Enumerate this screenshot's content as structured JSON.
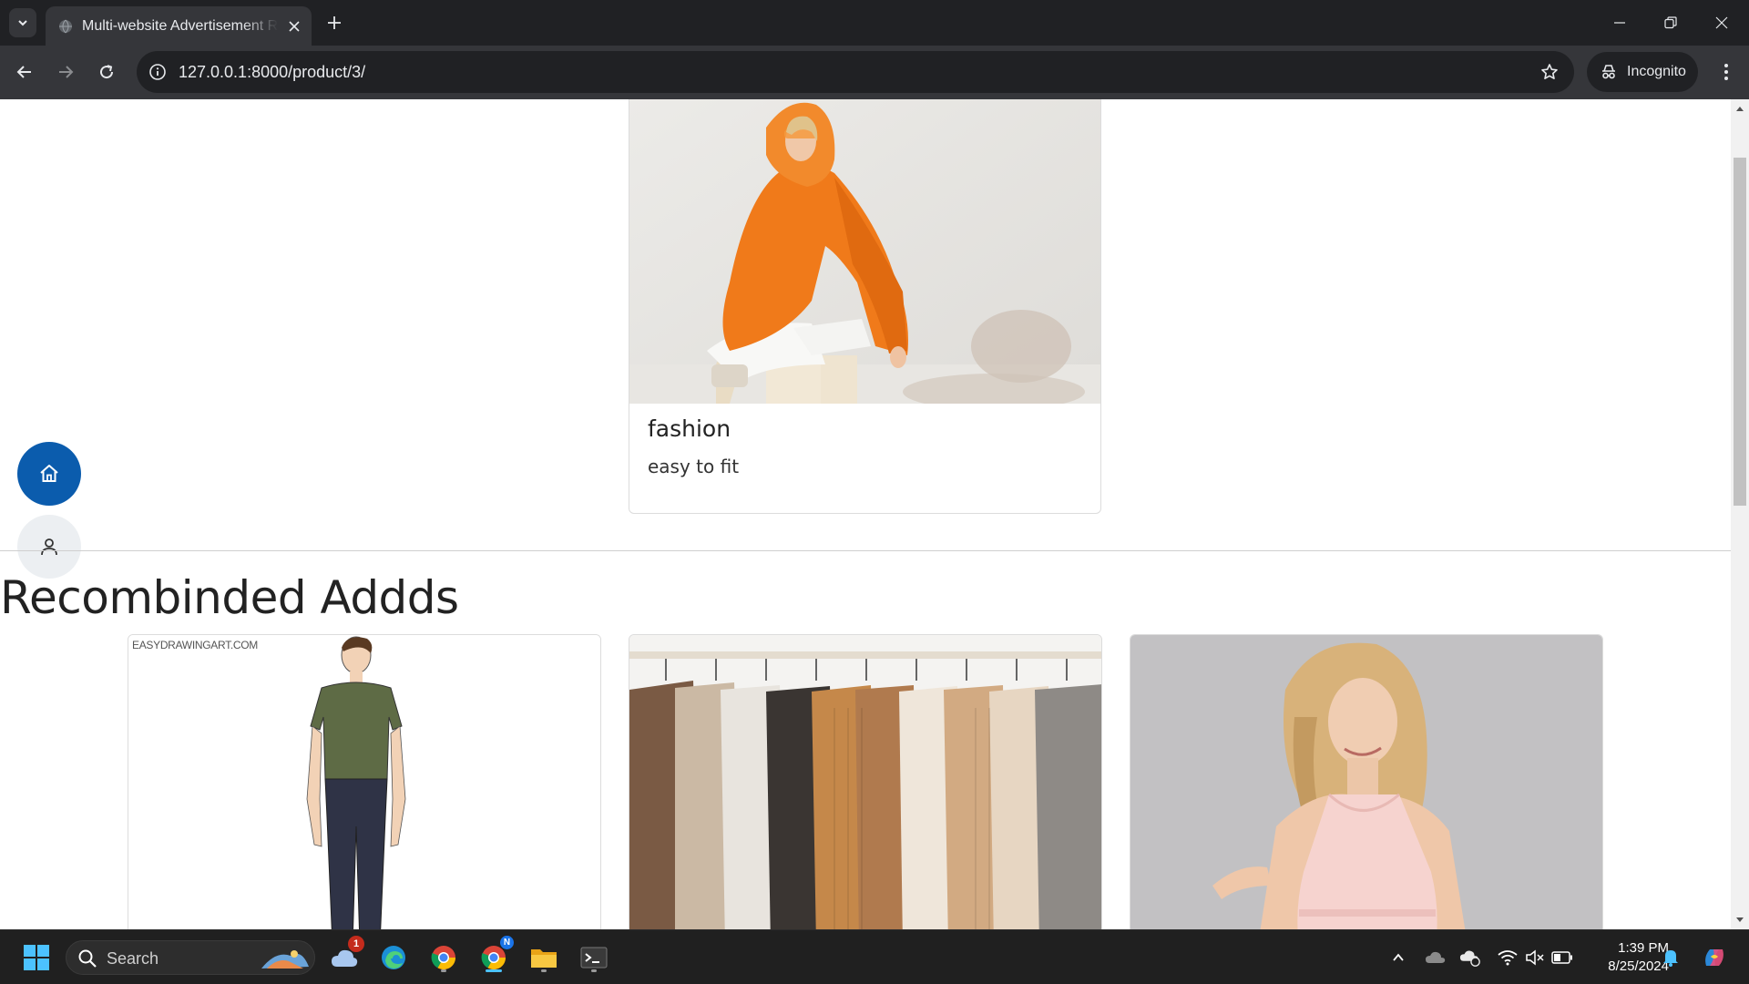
{
  "browser": {
    "tab_title": "Multi-website Advertisement Re",
    "url": "127.0.0.1:8000/product/3/",
    "incognito_label": "Incognito"
  },
  "product": {
    "name": "fashion",
    "description": "easy to fit"
  },
  "recommended": {
    "title": "Recombinded Addds",
    "cards": [
      {
        "watermark": "EASYDRAWINGART.COM",
        "image": "man-in-green-tshirt-drawing"
      },
      {
        "image": "clothes-rack"
      },
      {
        "image": "woman-pink-dress"
      }
    ]
  },
  "floating_buttons": [
    "home-icon",
    "user-icon"
  ],
  "taskbar": {
    "search_placeholder": "Search",
    "weather_badge": "1",
    "time": "1:39 PM",
    "date": "8/25/2024",
    "chrome_profile_badge": "N"
  },
  "colors": {
    "home_fab": "#0b5cad",
    "chrome_dark": "#202124",
    "chrome_toolbar": "#35363a",
    "hoodie_orange": "#f07a1a"
  }
}
